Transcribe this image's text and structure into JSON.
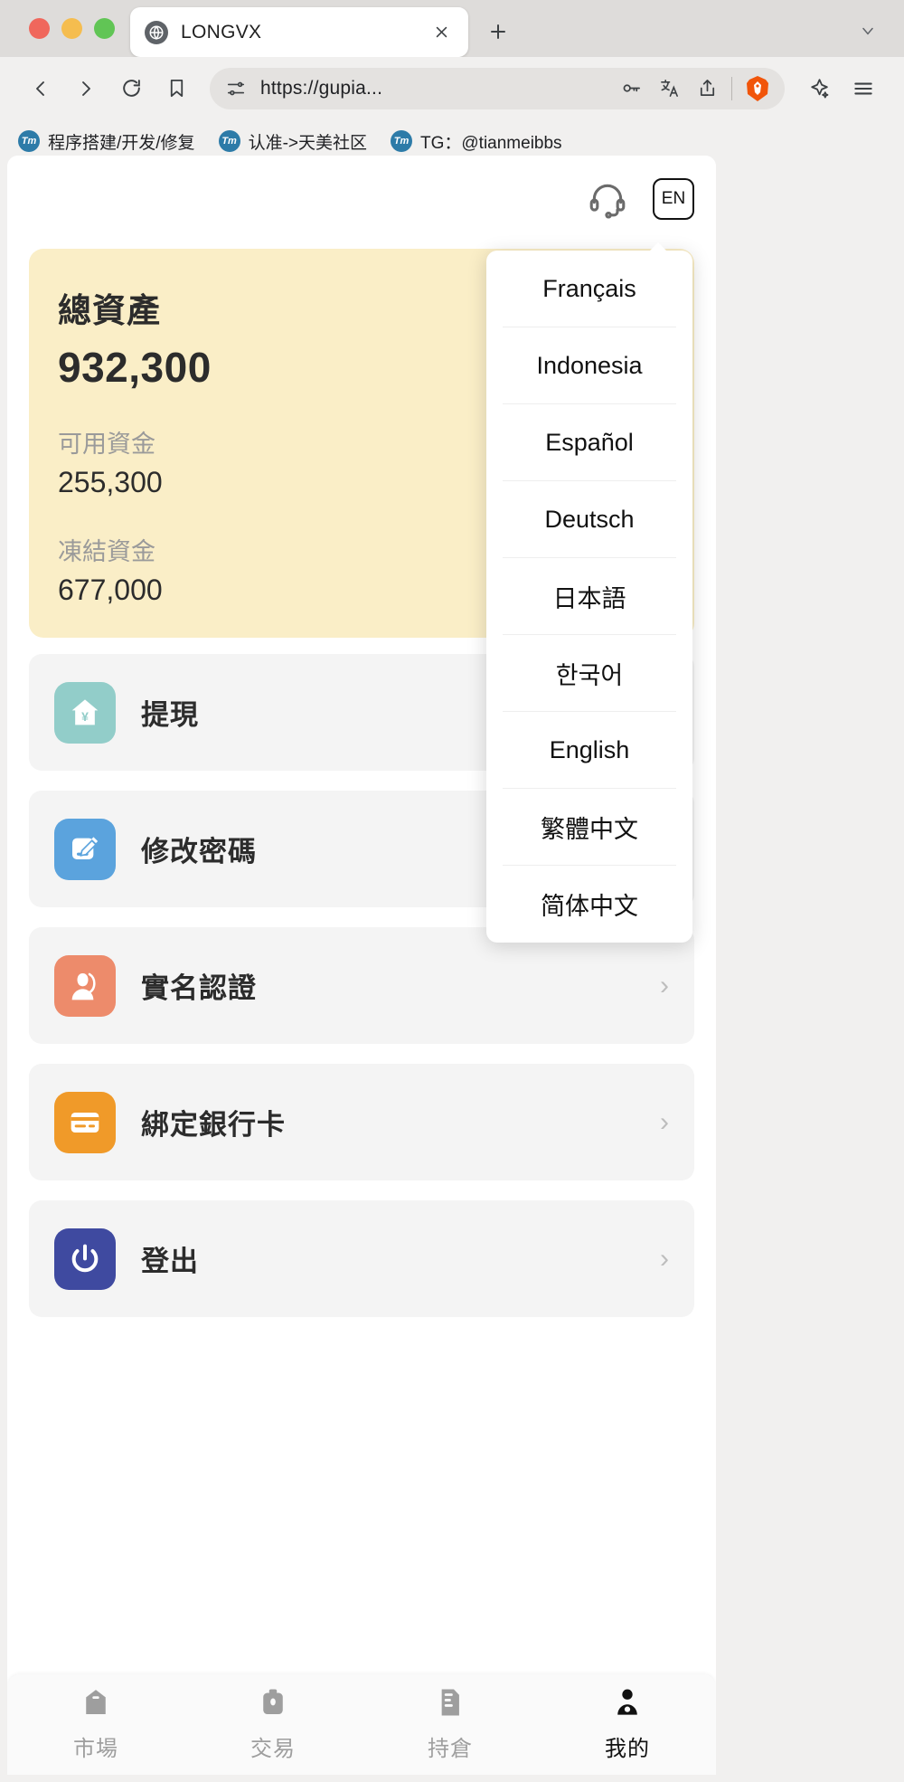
{
  "browser": {
    "tab": {
      "title": "LONGVX",
      "favicon_icon": "globe-icon",
      "close_icon": "close-icon"
    },
    "new_tab_icon": "plus-icon",
    "tab_list_icon": "chevron-down-icon",
    "nav": {
      "back_icon": "back-arrow-icon",
      "forward_icon": "forward-arrow-icon",
      "reload_icon": "reload-icon",
      "bookmark_icon": "bookmark-icon"
    },
    "omnibox": {
      "settings_icon": "site-settings-icon",
      "url": "https://gupia...",
      "password_icon": "key-icon",
      "translate_icon": "translate-icon",
      "share_icon": "share-icon",
      "shield_icon": "brave-lion-icon"
    },
    "toolbar": {
      "leo_icon": "sparkle-icon",
      "menu_icon": "hamburger-menu-icon"
    },
    "bookmarks": [
      {
        "icon": "tm-badge-icon",
        "label": "程序搭建/开发/修复"
      },
      {
        "icon": "tm-badge-icon",
        "label": "认准->天美社区"
      },
      {
        "icon": "tm-badge-icon",
        "label": "TG：@tianmeibbs"
      }
    ]
  },
  "page": {
    "header": {
      "support_icon": "headset-icon",
      "language_button_label": "EN"
    },
    "language_menu": {
      "items": [
        {
          "label": "Français"
        },
        {
          "label": "Indonesia"
        },
        {
          "label": "Español"
        },
        {
          "label": "Deutsch"
        },
        {
          "label": "日本語"
        },
        {
          "label": "한국어"
        },
        {
          "label": "English"
        },
        {
          "label": "繁體中文"
        },
        {
          "label": "简体中文"
        }
      ]
    },
    "asset_card": {
      "title": "總資產",
      "total": "932,300",
      "available_label": "可用資金",
      "available_value": "255,300",
      "frozen_label": "凍結資金",
      "frozen_value": "677,000",
      "background_color": "#faeec7"
    },
    "menu": [
      {
        "label": "提現",
        "icon": "house-yen-icon",
        "icon_color": "#92cdc9",
        "chevron": "›"
      },
      {
        "label": "修改密碼",
        "icon": "edit-pencil-icon",
        "icon_color": "#5ba3dd",
        "chevron": "›"
      },
      {
        "label": "實名認證",
        "icon": "person-id-icon",
        "icon_color": "#ed8b6b",
        "chevron": "›"
      },
      {
        "label": "綁定銀行卡",
        "icon": "bank-card-icon",
        "icon_color": "#f09a29",
        "chevron": "›"
      },
      {
        "label": "登出",
        "icon": "power-off-icon",
        "icon_color": "#3f4aa0",
        "chevron": "›"
      }
    ],
    "tabbar": [
      {
        "label": "市場",
        "icon": "market-tag-icon",
        "active": false
      },
      {
        "label": "交易",
        "icon": "briefcase-icon",
        "active": false
      },
      {
        "label": "持倉",
        "icon": "holdings-doc-icon",
        "active": false
      },
      {
        "label": "我的",
        "icon": "user-profile-icon",
        "active": true
      }
    ]
  }
}
